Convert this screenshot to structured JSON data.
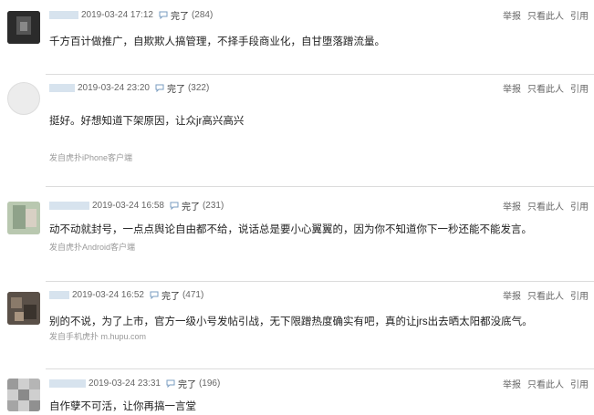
{
  "actions": {
    "report": "举报",
    "only_this": "只看此人",
    "quote": "引用"
  },
  "colors": {
    "background": "#ffffff",
    "divider": "#dcdcdc",
    "link_blue": "#3a6ea5",
    "muted": "#999999"
  },
  "posts": [
    {
      "time": "2019-03-24 17:12",
      "author": "完了",
      "count": "(284)",
      "content": "千方百计做推广，自欺欺人搞管理，不择手段商业化，自甘堕落蹭流量。",
      "source": ""
    },
    {
      "time": "2019-03-24 23:20",
      "author": "完了",
      "count": "(322)",
      "content": "挺好。好想知道下架原因，让众jr高兴高兴",
      "source": "发自虎扑iPhone客户端"
    },
    {
      "time": "2019-03-24 16:58",
      "author": "完了",
      "count": "(231)",
      "content": "动不动就封号，一点点舆论自由都不给，说话总是要小心翼翼的，因为你不知道你下一秒还能不能发言。",
      "source": "发自虎扑Android客户端"
    },
    {
      "time": "2019-03-24 16:52",
      "author": "完了",
      "count": "(471)",
      "content": "别的不说，为了上市，官方一级小号发帖引战，无下限蹭热度确实有吧，真的让jrs出去晒太阳都没底气。",
      "source": "发自手机虎扑 m.hupu.com"
    },
    {
      "time": "2019-03-24 23:31",
      "author": "完了",
      "count": "(196)",
      "content": "自作孽不可活，让你再搞一言堂",
      "source": ""
    }
  ]
}
